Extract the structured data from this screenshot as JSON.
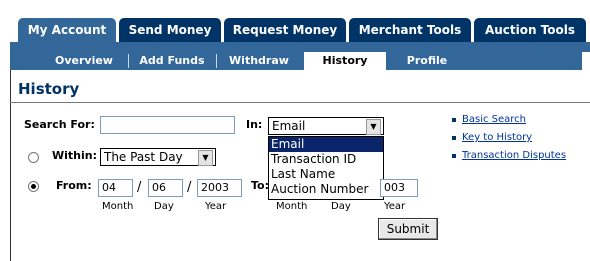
{
  "tabs": [
    {
      "label": "My Account",
      "active": true
    },
    {
      "label": "Send Money",
      "active": false
    },
    {
      "label": "Request Money",
      "active": false
    },
    {
      "label": "Merchant Tools",
      "active": false
    },
    {
      "label": "Auction Tools",
      "active": false
    }
  ],
  "subnav": [
    {
      "label": "Overview",
      "active": false
    },
    {
      "label": "Add Funds",
      "active": false
    },
    {
      "label": "Withdraw",
      "active": false
    },
    {
      "label": "History",
      "active": true
    },
    {
      "label": "Profile",
      "active": false
    }
  ],
  "page": {
    "title": "History"
  },
  "form": {
    "search_for_label": "Search For:",
    "search_for_value": "",
    "in_label": "In:",
    "in_value": "Email",
    "in_options": [
      "Email",
      "Transaction ID",
      "Last Name",
      "Auction Number"
    ],
    "within_label": "Within:",
    "within_value": "The Past Day",
    "from_label": "From:",
    "from_month": "04",
    "from_day": "06",
    "from_year": "2003",
    "to_label": "To:",
    "to_year_partial": "003",
    "date_sep": "/",
    "month_label": "Month",
    "day_label": "Day",
    "year_label": "Year",
    "submit_label": "Submit",
    "within_selected": false,
    "from_selected": true
  },
  "side_links": [
    "Basic Search",
    "Key to History",
    "Transaction Disputes"
  ],
  "colors": {
    "tab_bg": "#003366",
    "tab_active": "#336699",
    "title": "#003366",
    "selection": "#0a246a"
  }
}
